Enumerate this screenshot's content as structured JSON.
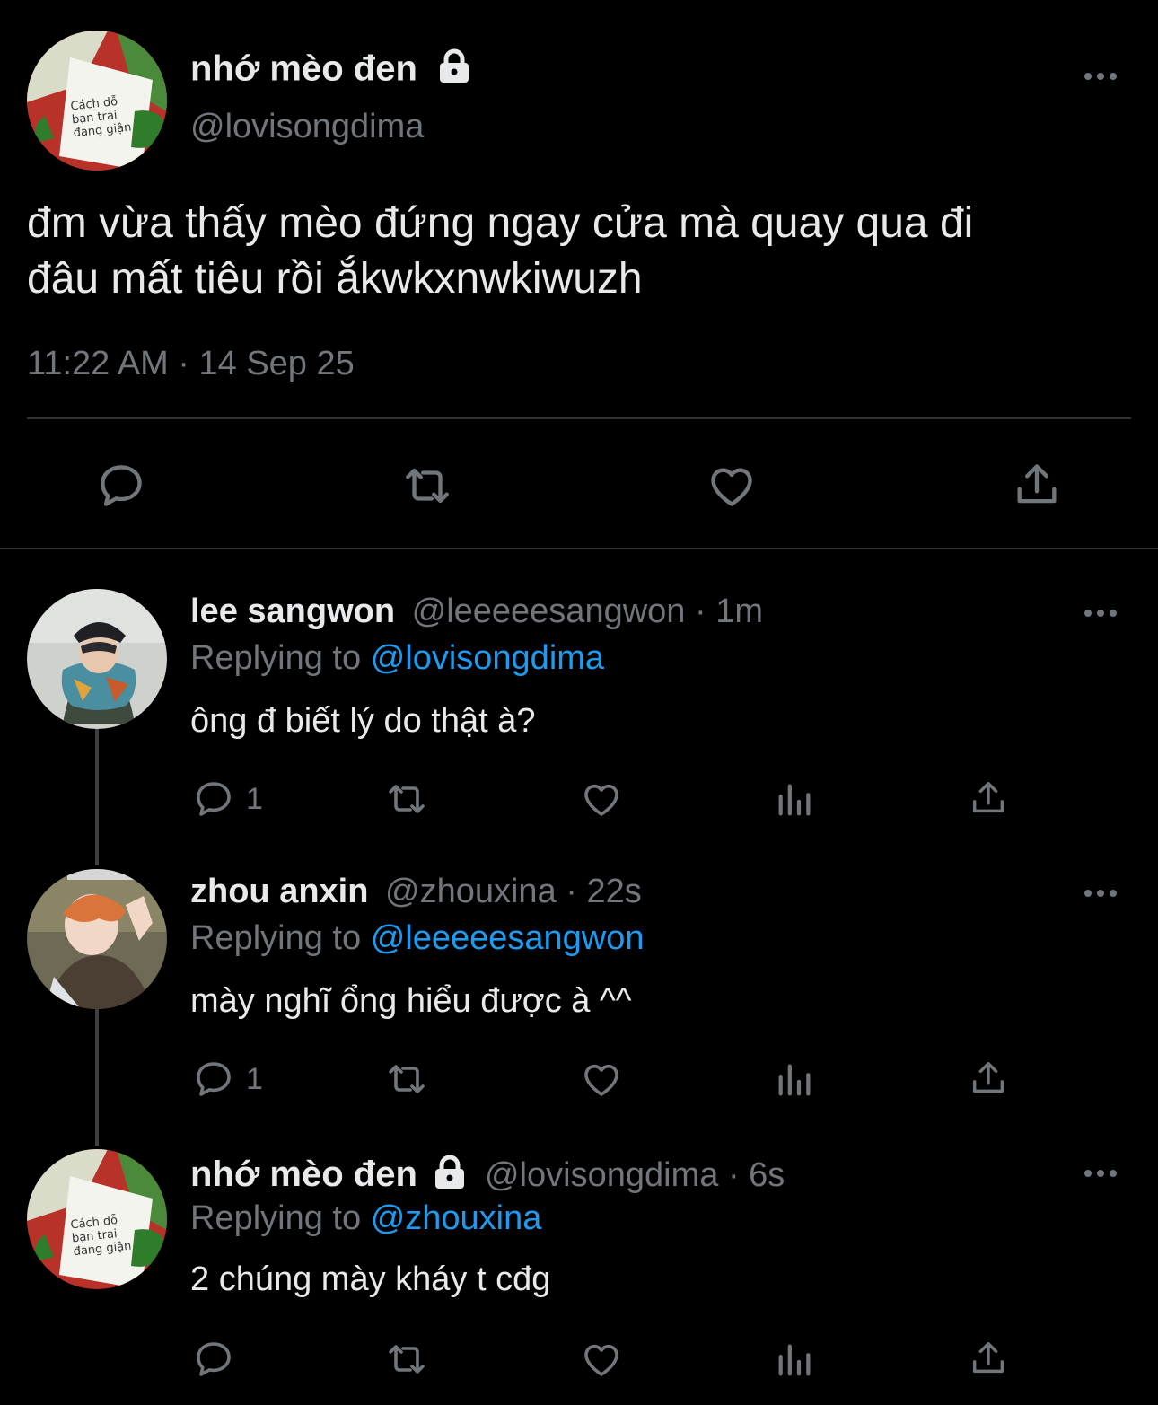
{
  "main_tweet": {
    "display_name": "nhớ mèo đen",
    "handle": "@lovisongdima",
    "avatar_text": [
      "Cách dỗ",
      "bạn trai",
      "đang giận"
    ],
    "text_lines": [
      "đm vừa thấy mèo đứng ngay cửa mà quay qua đi",
      "đâu mất tiêu rồi ắkwkxnwkiwuzh"
    ],
    "timestamp": "11:22 AM · 14 Sep 25",
    "actions": [
      "reply-icon",
      "retweet-icon",
      "like-icon",
      "share-icon"
    ]
  },
  "replies": [
    {
      "display_name": "lee sangwon",
      "handle": "@leeeeesangwon",
      "time": "1m",
      "replying_label": "Replying to",
      "replying_to": "@lovisongdima",
      "text": "ông đ biết lý do thật à?",
      "reply_count": "1"
    },
    {
      "display_name": "zhou anxin",
      "handle": "@zhouxina",
      "time": "22s",
      "replying_label": "Replying to",
      "replying_to": "@leeeeesangwon",
      "text": "mày nghĩ ổng hiểu được à ^^",
      "reply_count": "1"
    },
    {
      "display_name": "nhớ mèo đen",
      "handle": "@lovisongdima",
      "time": "6s",
      "replying_label": "Replying to",
      "replying_to": "@zhouxina",
      "text": "2 chúng mày kháy t cđg",
      "reply_count": "",
      "avatar_text": [
        "Cách dỗ",
        "bạn trai",
        "đang giận"
      ]
    }
  ],
  "colors": {
    "background": "#000000",
    "muted": "#71767b",
    "link": "#1d9bf0",
    "text": "#e7e9ea",
    "divider": "#2f3336"
  }
}
